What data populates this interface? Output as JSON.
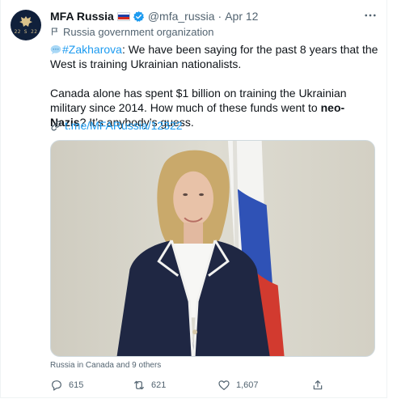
{
  "account": {
    "name": "MFA Russia",
    "handle": "@mfa_russia",
    "separator": "·",
    "date": "Apr 12",
    "label": "Russia government organization",
    "avatar_text": "22 S 22"
  },
  "tweet": {
    "hashtag": "#Zakharova",
    "line1": ": We have been saying for the past 8 years that the West is training Ukrainian nationalists.",
    "line2_before": "Canada alone has spent $1 billion on training the Ukrainian military since 2014. How much of these funds went to ",
    "line2_bold": "neo-Nazis",
    "line2_after": "? It’s anybody’s guess.",
    "link": "t.me/MFARussia/12322"
  },
  "media": {
    "tagged": "Russia in Canada and 9 others"
  },
  "actions": {
    "replies": "615",
    "retweets": "621",
    "likes": "1,607"
  },
  "colors": {
    "accent": "#1d9bf0",
    "text": "#0f1419",
    "muted": "#536471",
    "border": "#cfd9de"
  },
  "icons": {
    "more": "more-icon",
    "verified": "verified-badge-icon",
    "organization": "flag-icon",
    "speech": "speech-balloon-icon",
    "link": "link-icon",
    "reply": "reply-icon",
    "retweet": "retweet-icon",
    "like": "heart-icon",
    "share": "share-icon"
  }
}
